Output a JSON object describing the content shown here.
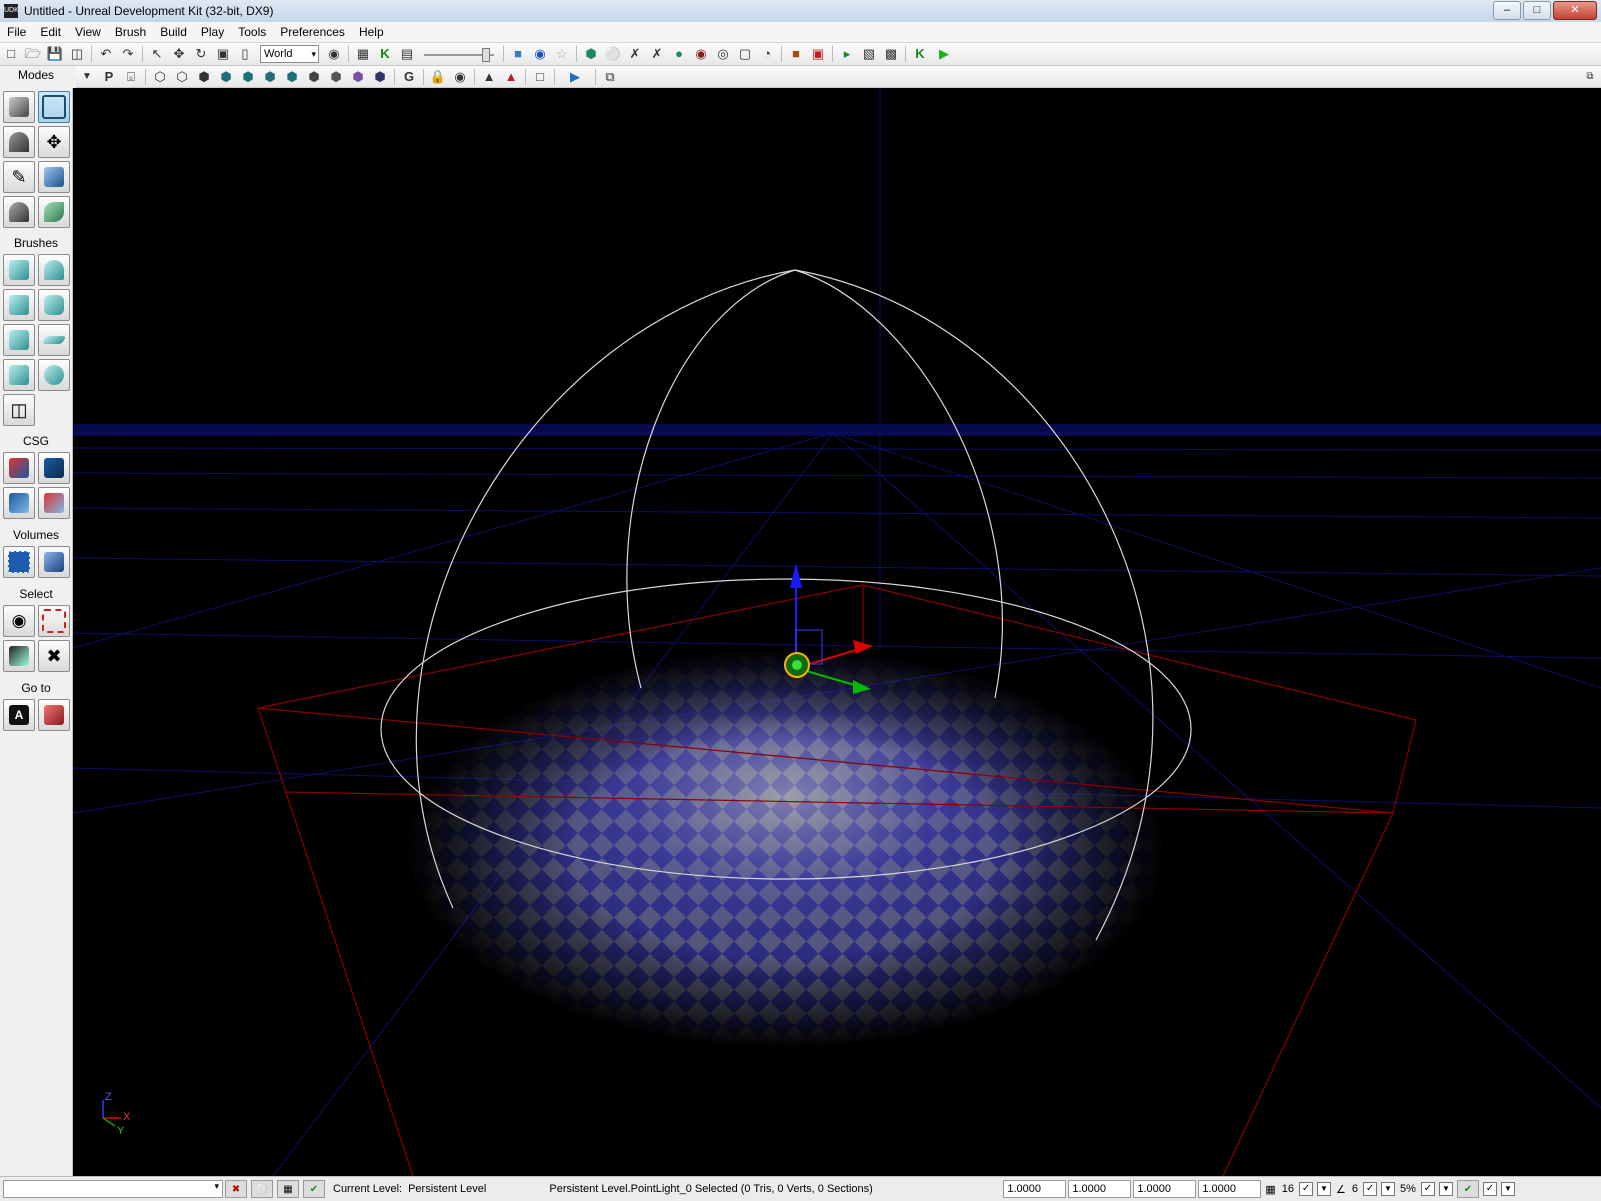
{
  "window": {
    "title": "Untitled - Unreal Development Kit (32-bit, DX9)",
    "app_icon_text": "UDK",
    "minimize": "–",
    "maximize": "□",
    "close": "✕"
  },
  "menu": [
    "File",
    "Edit",
    "View",
    "Brush",
    "Build",
    "Play",
    "Tools",
    "Preferences",
    "Help"
  ],
  "toolbar": {
    "coord_system": "World",
    "combo_arrow": "▾"
  },
  "sidebar": {
    "modes_label": "Modes",
    "brushes_label": "Brushes",
    "csg_label": "CSG",
    "volumes_label": "Volumes",
    "select_label": "Select",
    "goto_label": "Go to",
    "goto_button_text": "A"
  },
  "viewport": {
    "axis_x": "X",
    "axis_y": "Y",
    "axis_z": "Z",
    "grid_color": "#0b0f6b",
    "bounds_color": "#8b0000",
    "radius_color": "#d8d8d8"
  },
  "status": {
    "current_level_label": "Current Level:",
    "current_level_value": "Persistent Level",
    "selection_text": "Persistent Level.PointLight_0 Selected (0 Tris, 0 Verts, 0 Sections)",
    "drag_grid": [
      "1.0000",
      "1.0000",
      "1.0000",
      "1.0000"
    ],
    "grid_size": "16",
    "rotation_snap": "6",
    "scale_snap": "5%"
  }
}
